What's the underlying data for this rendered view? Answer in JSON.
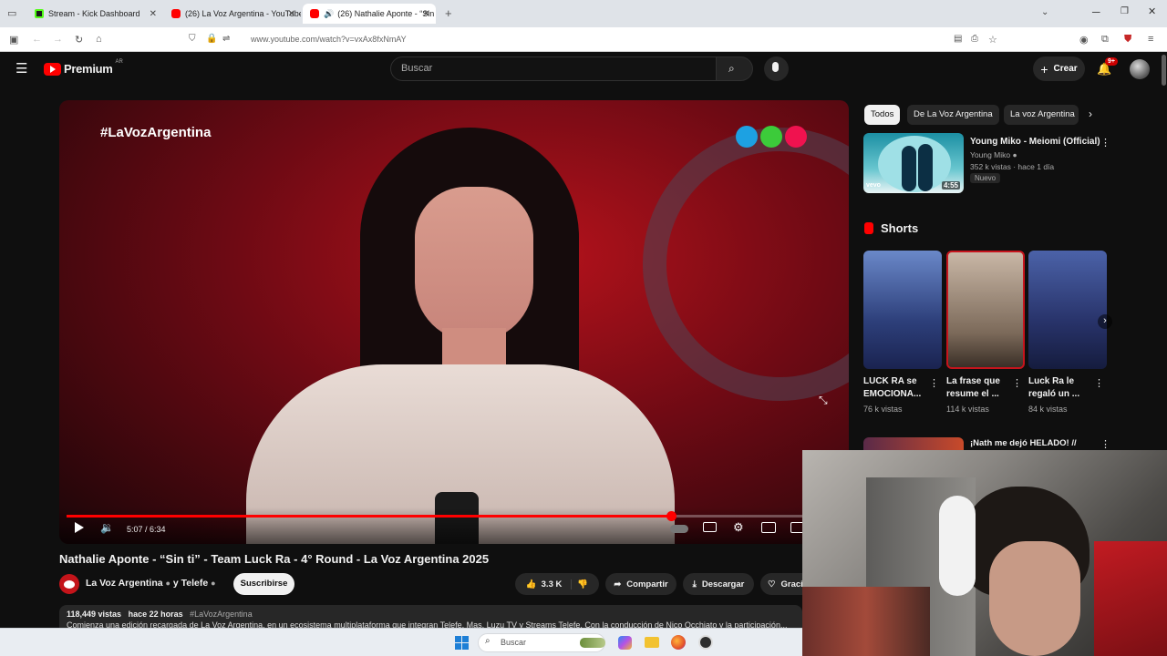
{
  "browser": {
    "tabs": [
      {
        "label": "Stream - Kick Dashboard",
        "active": false,
        "favicon_color": "#53fc18"
      },
      {
        "label": "(26) La Voz Argentina - YouTube",
        "active": false,
        "favicon_color": "#ff0000"
      },
      {
        "label": "(26) Nathalie Aponte - “Sin",
        "active": true,
        "favicon_color": "#ff0000"
      }
    ],
    "url": "www.youtube.com/watch?v=vxAx8fxNmAY"
  },
  "youtube": {
    "logo_text": "Premium",
    "logo_region": "AR",
    "search_placeholder": "Buscar",
    "create_label": "Crear",
    "notifications_badge": "9+"
  },
  "player": {
    "overlay_hashtag": "#LaVozArgentina",
    "time_display": "5:07 / 6:34",
    "progress_fraction": 0.78,
    "accent_color": "#ff0000"
  },
  "video": {
    "title": "Nathalie Aponte - “Sin ti” - Team Luck Ra - 4° Round - La Voz Argentina 2025",
    "channel": "La Voz Argentina",
    "channel_and": "y Telefe",
    "subscribe_label": "Suscribirse",
    "likes": "3.3 K",
    "share_label": "Compartir",
    "download_label": "Descargar",
    "thanks_label": "Graci",
    "views": "118,449 vistas",
    "age": "hace 22 horas",
    "hashtag": "#LaVozArgentina",
    "description_snippet": "Comienza una edición recargada de La Voz Argentina, en un ecosistema multiplataforma que integran Telefe, Mas, Luzu TV y Streams Telefe. Con la conducción de Nico Occhiato y la participación..."
  },
  "sidebar": {
    "chips": [
      "Todos",
      "De La Voz Argentina",
      "La voz Argentina"
    ],
    "recommended": {
      "title": "Young Miko - Meiomi (Official)",
      "channel": "Young Miko",
      "meta": "352 k vistas · hace 1 día",
      "badge": "Nuevo",
      "duration": "4:55",
      "thumb_label": "vevo"
    },
    "shorts_heading": "Shorts",
    "shorts": [
      {
        "title": "LUCK RA se EMOCIONA...",
        "views": "76 k vistas"
      },
      {
        "title": "La frase que resume el ...",
        "views": "114 k vistas"
      },
      {
        "title": "Luck Ra le regaló un ...",
        "views": "84 k vistas"
      }
    ],
    "next_title": "¡Nath me dejó HELADO! //"
  },
  "taskbar": {
    "search_placeholder": "Buscar"
  }
}
